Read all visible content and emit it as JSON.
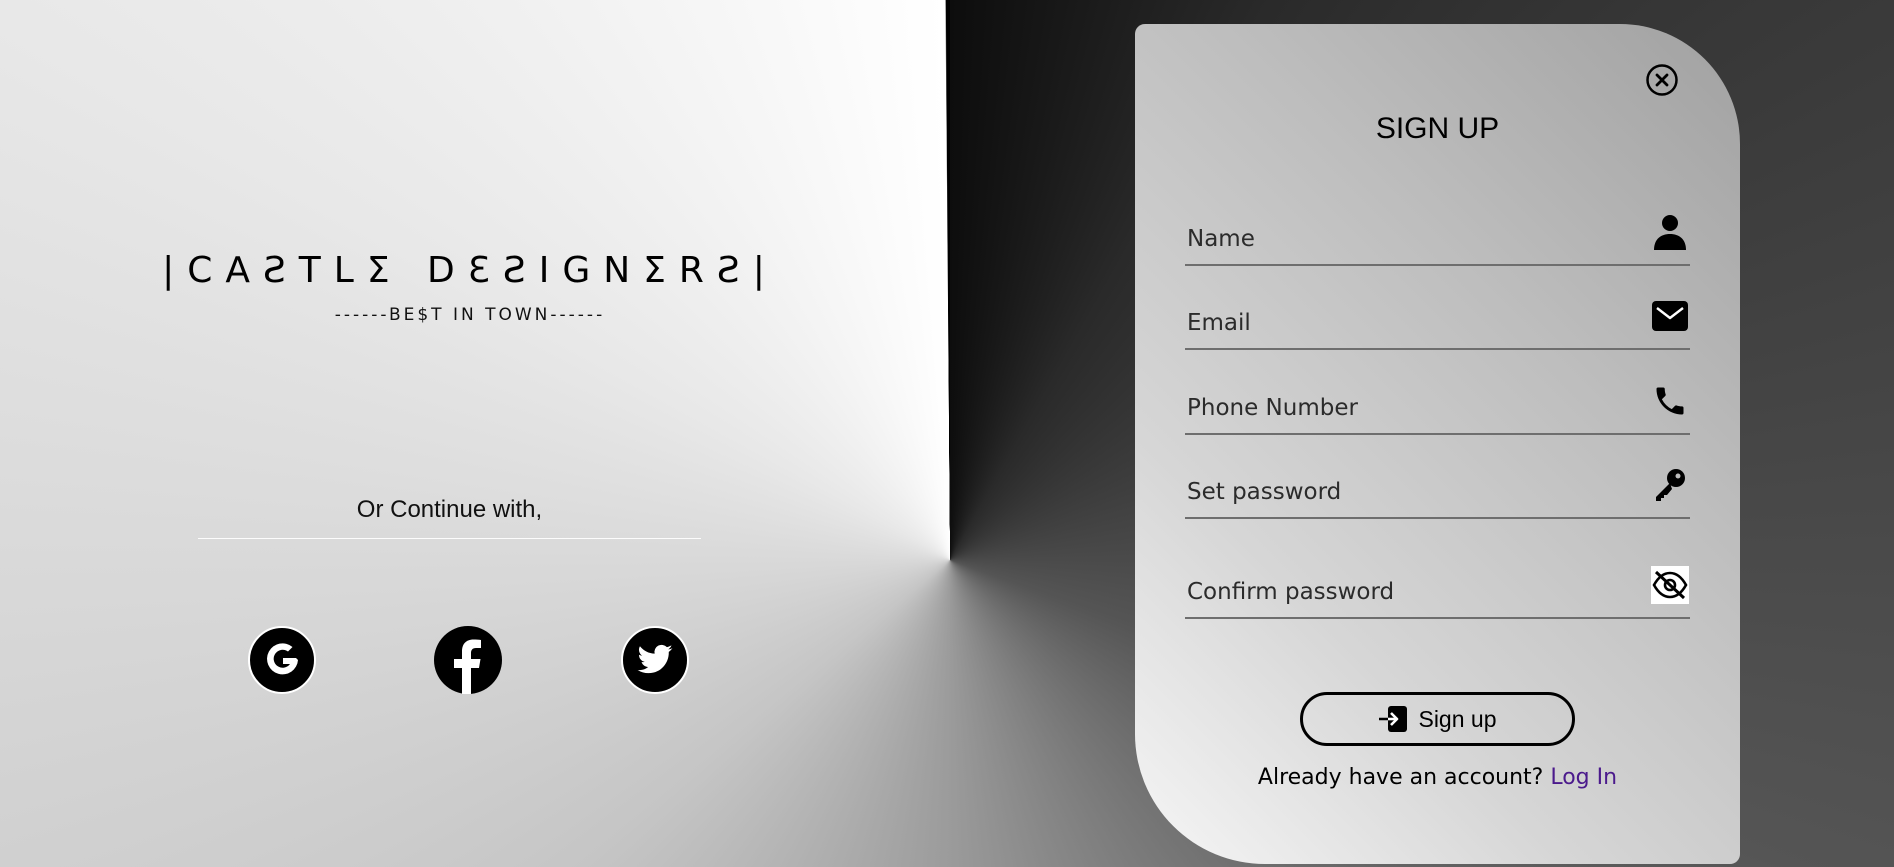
{
  "brand": {
    "title": "|CAƧTLƩ DƐƧIGNƩRƧ|",
    "tagline": "------BE$T IN TOWN------"
  },
  "social": {
    "continue_text": "Or Continue with,",
    "providers": [
      "google-icon",
      "facebook-icon",
      "twitter-icon"
    ]
  },
  "signup": {
    "title": "SIGN UP",
    "fields": {
      "name": {
        "placeholder": "Name",
        "value": "",
        "icon": "user-icon"
      },
      "email": {
        "placeholder": "Email",
        "value": "",
        "icon": "envelope-icon"
      },
      "phone": {
        "placeholder": "Phone Number",
        "value": "",
        "icon": "phone-icon"
      },
      "password": {
        "placeholder": "Set password",
        "value": "",
        "icon": "key-icon"
      },
      "confirm": {
        "placeholder": "Confirm password",
        "value": "",
        "icon": "eye-slash-icon"
      }
    },
    "button_label": "Sign up",
    "login_prompt": "Already have an account?",
    "login_link": "Log In"
  },
  "colors": {
    "link": "#4b1a8c",
    "text": "#000000",
    "field_border": "#6e6e6e"
  }
}
